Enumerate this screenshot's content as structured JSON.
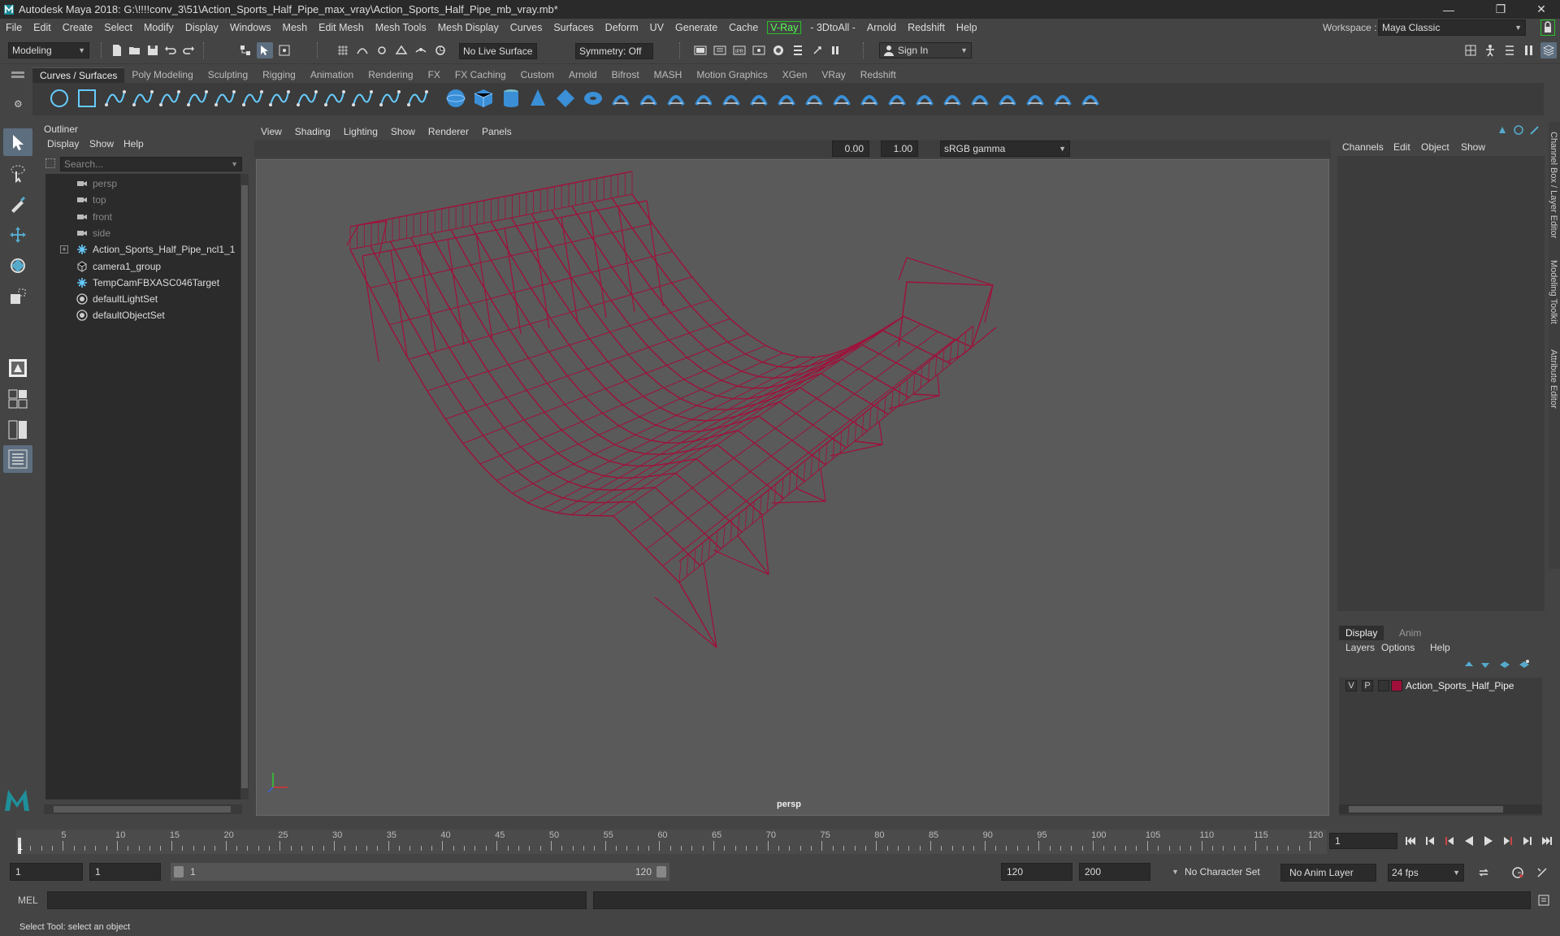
{
  "window": {
    "title": "Autodesk Maya 2018: G:\\!!!!conv_3\\51\\Action_Sports_Half_Pipe_max_vray\\Action_Sports_Half_Pipe_mb_vray.mb*",
    "minimize": "—",
    "maximize": "❐",
    "close": "✕"
  },
  "menubar": {
    "items": [
      "File",
      "Edit",
      "Create",
      "Select",
      "Modify",
      "Display",
      "Windows",
      "Mesh",
      "Edit Mesh",
      "Mesh Tools",
      "Mesh Display",
      "Curves",
      "Surfaces",
      "Deform",
      "UV",
      "Generate",
      "Cache",
      "V-Ray",
      "- 3DtoAll -",
      "Arnold",
      "Redshift",
      "Help"
    ],
    "workspace_label": "Workspace :",
    "workspace_value": "Maya Classic"
  },
  "statusline": {
    "mode": "Modeling",
    "live_surface": "No Live Surface",
    "symmetry": "Symmetry: Off",
    "sign_in": "Sign In"
  },
  "shelf": {
    "tabs": [
      "Curves / Surfaces",
      "Poly Modeling",
      "Sculpting",
      "Rigging",
      "Animation",
      "Rendering",
      "FX",
      "FX Caching",
      "Custom",
      "Arnold",
      "Bifrost",
      "MASH",
      "Motion Graphics",
      "XGen",
      "VRay",
      "Redshift"
    ],
    "active_tab": "Curves / Surfaces"
  },
  "outliner": {
    "title": "Outliner",
    "menus": [
      "Display",
      "Show",
      "Help"
    ],
    "search_placeholder": "Search...",
    "items": [
      {
        "name": "persp",
        "icon": "camera-icon",
        "dim": true
      },
      {
        "name": "top",
        "icon": "camera-icon",
        "dim": true
      },
      {
        "name": "front",
        "icon": "camera-icon",
        "dim": true
      },
      {
        "name": "side",
        "icon": "camera-icon",
        "dim": true
      },
      {
        "name": "Action_Sports_Half_Pipe_ncl1_1",
        "icon": "joint-icon",
        "dim": false,
        "expand": "+"
      },
      {
        "name": "camera1_group",
        "icon": "group-icon",
        "dim": false
      },
      {
        "name": "TempCamFBXASC046Target",
        "icon": "joint-icon",
        "dim": false
      },
      {
        "name": "defaultLightSet",
        "icon": "set-icon",
        "dim": false
      },
      {
        "name": "defaultObjectSet",
        "icon": "set-icon",
        "dim": false
      }
    ]
  },
  "viewport": {
    "menus": [
      "View",
      "Shading",
      "Lighting",
      "Show",
      "Renderer",
      "Panels"
    ],
    "exposure": "0.00",
    "gamma": "1.00",
    "color_space": "sRGB gamma",
    "camera_label": "persp",
    "wire_color": "#a0103a"
  },
  "channel_box": {
    "menus": [
      "Channels",
      "Edit",
      "Object",
      "Show"
    ]
  },
  "side_tabs": [
    "Channel Box / Layer Editor",
    "Modeling Toolkit",
    "Attribute Editor"
  ],
  "layer_editor": {
    "tabs": [
      "Display",
      "Anim"
    ],
    "active_tab": "Display",
    "menus": [
      "Layers",
      "Options",
      "Help"
    ],
    "layers": [
      {
        "v": "V",
        "p": "P",
        "color": "#a0103a",
        "name": "Action_Sports_Half_Pipe"
      }
    ]
  },
  "timeslider": {
    "labels": [
      "5",
      "10",
      "15",
      "20",
      "25",
      "30",
      "35",
      "40",
      "45",
      "50",
      "55",
      "60",
      "65",
      "70",
      "75",
      "80",
      "85",
      "90",
      "95",
      "100",
      "105",
      "110",
      "115",
      "120"
    ],
    "first_label": "1",
    "current_frame": "1"
  },
  "range": {
    "start": "1",
    "playback_start": "1",
    "slider_start": "1",
    "slider_end": "120",
    "playback_end": "120",
    "end": "200",
    "character_set": "No Character Set",
    "anim_layer": "No Anim Layer",
    "fps": "24 fps"
  },
  "command_line": {
    "lang": "MEL"
  },
  "help_line": "Select Tool: select an object"
}
